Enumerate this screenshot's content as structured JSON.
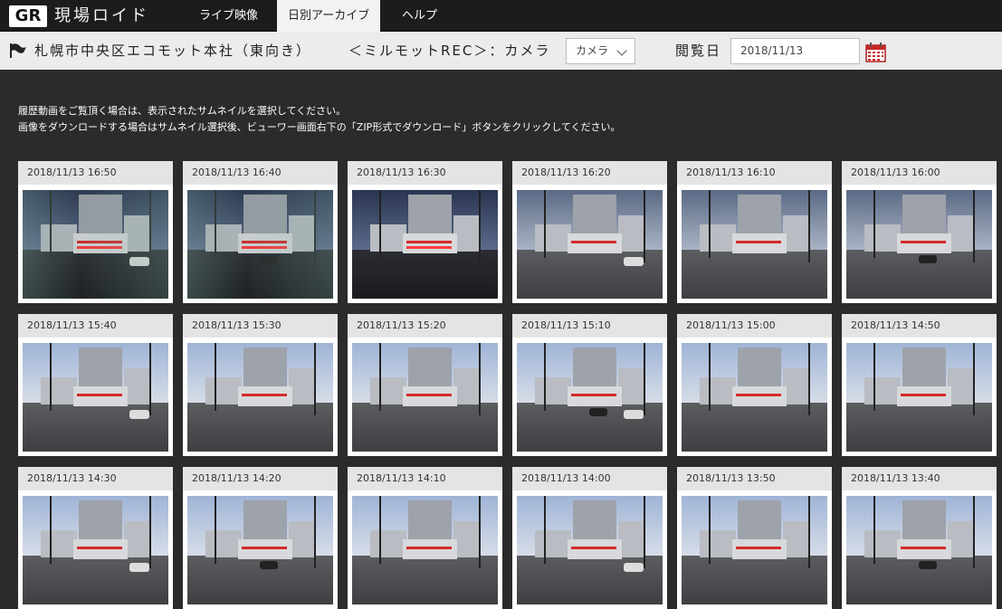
{
  "header": {
    "logo": "GR",
    "app_name": "現場ロイド",
    "tabs": [
      {
        "label": "ライブ映像",
        "active": false
      },
      {
        "label": "日別アーカイブ",
        "active": true
      },
      {
        "label": "ヘルプ",
        "active": false
      }
    ]
  },
  "subheader": {
    "location": "札幌市中央区エコモット本社（東向き）",
    "camera_label": "＜ミルモットREC＞：カメラ",
    "camera_select": "カメラ",
    "date_label": "閲覧日",
    "date_value": "2018/11/13"
  },
  "instructions": {
    "line1": "履歴動画をご覧頂く場合は、表示されたサムネイルを選択してください。",
    "line2": "画像をダウンロードする場合はサムネイル選択後、ビューワー画面右下の「ZIP形式でダウンロード」ボタンをクリックしてください。"
  },
  "thumbnails": [
    {
      "timestamp": "2018/11/13 16:50",
      "scene": "night-glass"
    },
    {
      "timestamp": "2018/11/13 16:40",
      "scene": "night-glass"
    },
    {
      "timestamp": "2018/11/13 16:30",
      "scene": "night"
    },
    {
      "timestamp": "2018/11/13 16:20",
      "scene": "dusk"
    },
    {
      "timestamp": "2018/11/13 16:10",
      "scene": "dusk"
    },
    {
      "timestamp": "2018/11/13 16:00",
      "scene": "dusk"
    },
    {
      "timestamp": "2018/11/13 15:40",
      "scene": "day"
    },
    {
      "timestamp": "2018/11/13 15:30",
      "scene": "day"
    },
    {
      "timestamp": "2018/11/13 15:20",
      "scene": "day"
    },
    {
      "timestamp": "2018/11/13 15:10",
      "scene": "day"
    },
    {
      "timestamp": "2018/11/13 15:00",
      "scene": "day"
    },
    {
      "timestamp": "2018/11/13 14:50",
      "scene": "day"
    },
    {
      "timestamp": "2018/11/13 14:30",
      "scene": "day"
    },
    {
      "timestamp": "2018/11/13 14:20",
      "scene": "day"
    },
    {
      "timestamp": "2018/11/13 14:10",
      "scene": "day"
    },
    {
      "timestamp": "2018/11/13 14:00",
      "scene": "day"
    },
    {
      "timestamp": "2018/11/13 13:50",
      "scene": "day"
    },
    {
      "timestamp": "2018/11/13 13:40",
      "scene": "day"
    }
  ],
  "icons": {
    "flag": "flag-icon",
    "calendar": "calendar-icon",
    "dropdown": "chevron-down-icon"
  },
  "colors": {
    "background": "#2b2b2b",
    "topbar": "#1c1c1c",
    "subbar": "#ececec",
    "accent_red": "#d42b2b"
  }
}
